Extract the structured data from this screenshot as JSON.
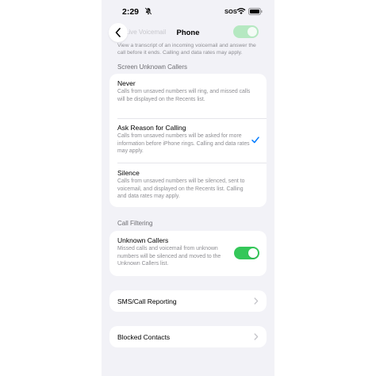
{
  "status_bar": {
    "time": "2:29",
    "sos": "SOS"
  },
  "nav": {
    "title": "Phone",
    "faded_row_label": "Live Voicemail"
  },
  "top_description": "View a transcript of an incoming voicemail and answer the call before it ends. Calling and data rates may apply.",
  "screen_unknown": {
    "header": "Screen Unknown Callers",
    "options": [
      {
        "title": "Never",
        "description": "Calls from unsaved numbers will ring, and missed calls will be displayed on the Recents list.",
        "selected": false
      },
      {
        "title": "Ask Reason for Calling",
        "description": "Calls from unsaved numbers will be asked for more information before iPhone rings. Calling and data rates may apply.",
        "selected": true
      },
      {
        "title": "Silence",
        "description": "Calls from unsaved numbers will be silenced, sent to voicemail, and displayed on the Recents list. Calling and data rates may apply.",
        "selected": false
      }
    ]
  },
  "call_filtering": {
    "header": "Call Filtering",
    "unknown_callers": {
      "title": "Unknown Callers",
      "description": "Missed calls and voicemail from unknown numbers will be silenced and moved to the Unknown Callers list.",
      "enabled": true
    }
  },
  "rows": {
    "sms_call_reporting": "SMS/Call Reporting",
    "blocked_contacts": "Blocked Contacts"
  },
  "colors": {
    "accent": "#007aff",
    "toggle_on": "#34c759",
    "background": "#f2f2f7"
  }
}
